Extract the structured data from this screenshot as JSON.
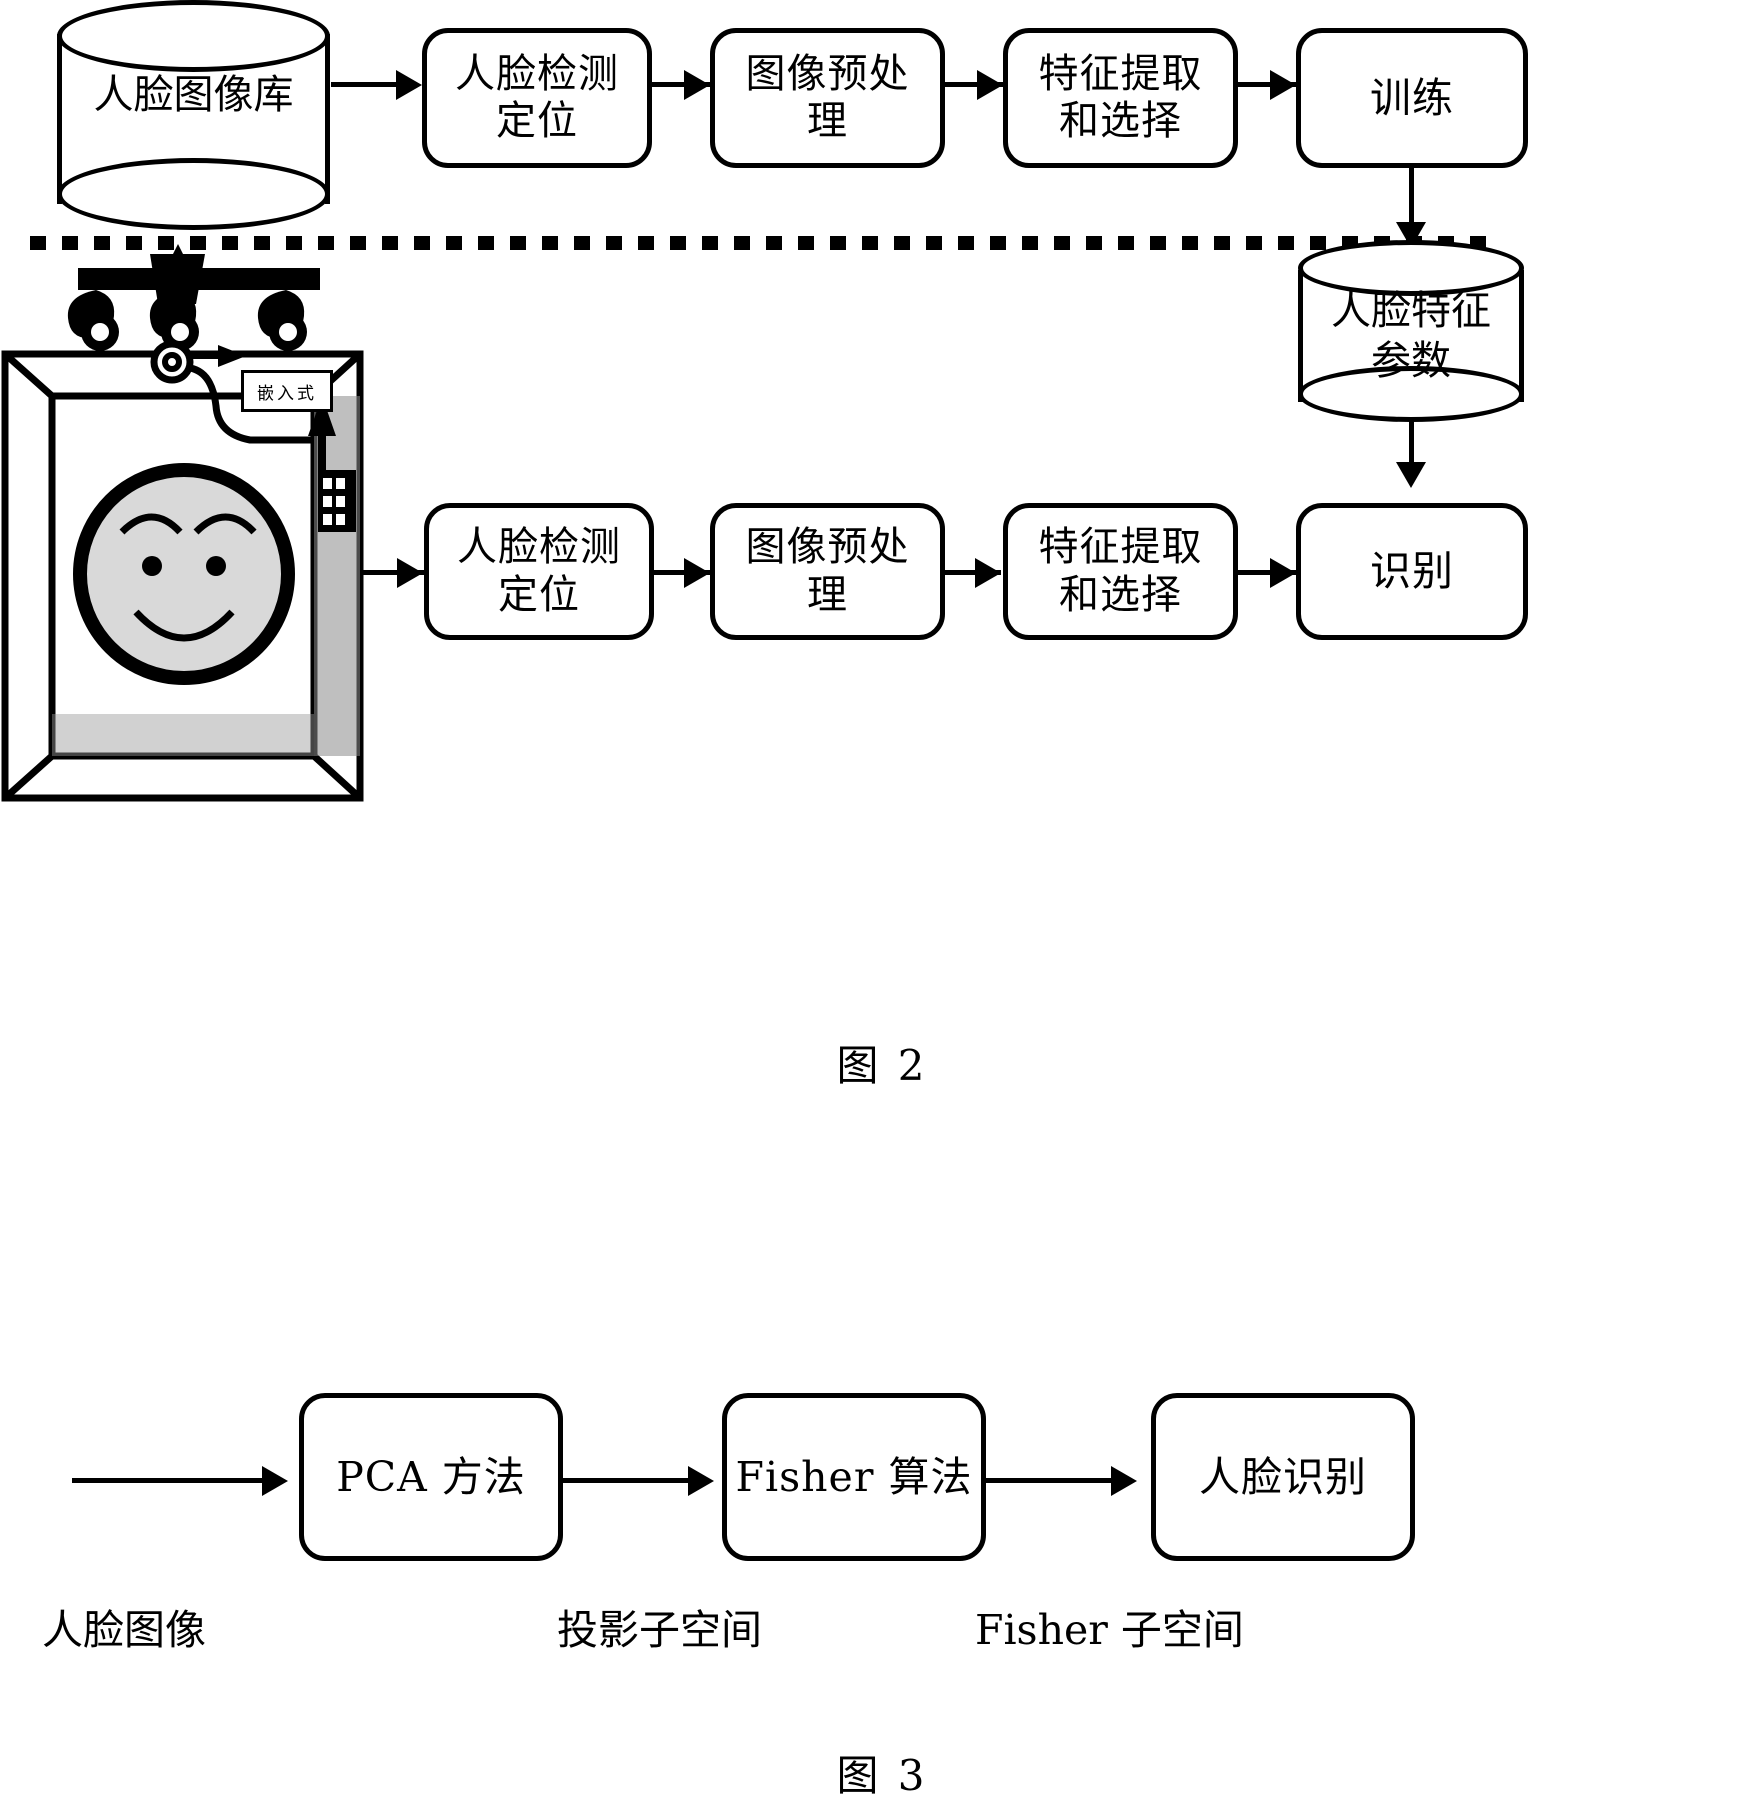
{
  "figure2": {
    "caption": "图 2",
    "training_row": {
      "database_label": [
        "人脸图像库"
      ],
      "steps": [
        {
          "lines": [
            "人脸检测",
            "定位"
          ]
        },
        {
          "lines": [
            "图像预处",
            "理"
          ]
        },
        {
          "lines": [
            "特征提取",
            "和选择"
          ]
        },
        {
          "lines": [
            "训练"
          ]
        }
      ]
    },
    "feature_store": {
      "lines": [
        "人脸特征",
        "参数"
      ]
    },
    "recognition_row": {
      "steps": [
        {
          "lines": [
            "人脸检测",
            "定位"
          ]
        },
        {
          "lines": [
            "图像预处",
            "理"
          ]
        },
        {
          "lines": [
            "特征提取",
            "和选择"
          ]
        },
        {
          "lines": [
            "识别"
          ]
        }
      ]
    },
    "device": {
      "embedded_label": "嵌入式",
      "camera_icon": "camera-lens-icon",
      "face_icon": "smiley-face-icon"
    },
    "divider": "dotted-separator-line"
  },
  "figure3": {
    "caption": "图 3",
    "steps": [
      {
        "label": "PCA 方法"
      },
      {
        "label": "Fisher 算法"
      },
      {
        "label": "人脸识别"
      }
    ],
    "annotations": [
      {
        "text": "人脸图像"
      },
      {
        "text": "投影子空间"
      },
      {
        "text": "Fisher 子空间"
      }
    ]
  }
}
